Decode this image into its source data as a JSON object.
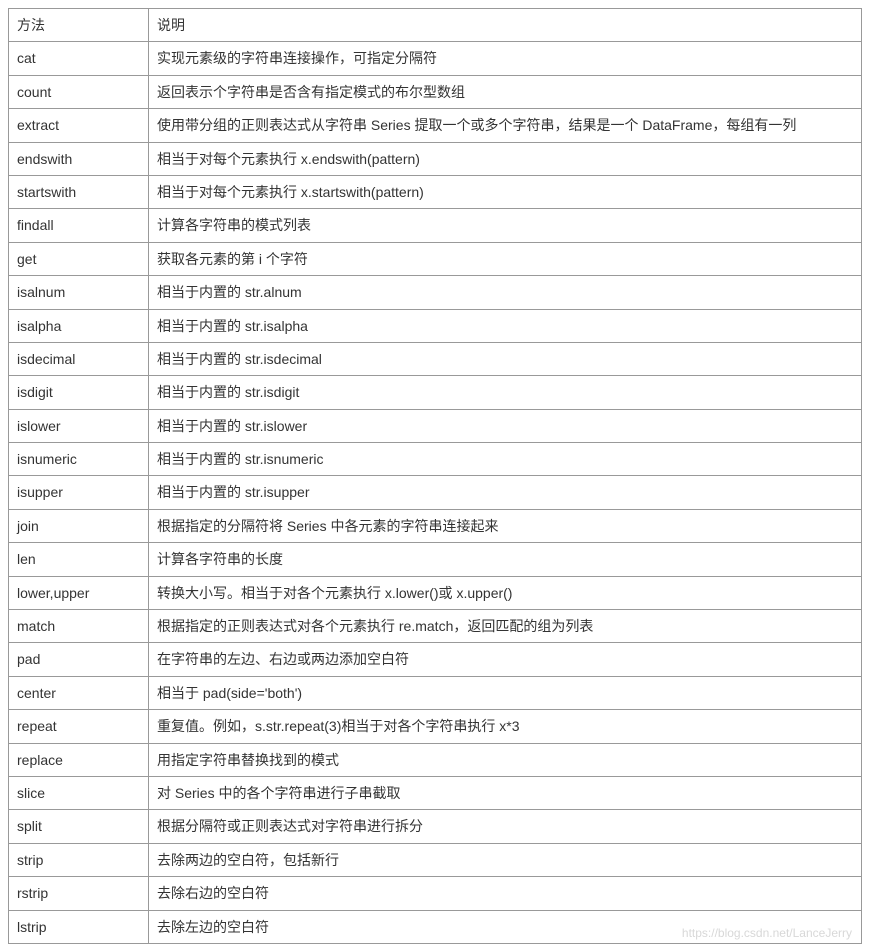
{
  "table": {
    "header": {
      "method": "方法",
      "desc": "说明"
    },
    "rows": [
      {
        "method": "cat",
        "desc": "实现元素级的字符串连接操作，可指定分隔符"
      },
      {
        "method": "count",
        "desc": "返回表示个字符串是否含有指定模式的布尔型数组"
      },
      {
        "method": "extract",
        "desc": "使用带分组的正则表达式从字符串 Series 提取一个或多个字符串，结果是一个 DataFrame，每组有一列"
      },
      {
        "method": "endswith",
        "desc": "相当于对每个元素执行 x.endswith(pattern)"
      },
      {
        "method": "startswith",
        "desc": "相当于对每个元素执行 x.startswith(pattern)"
      },
      {
        "method": "findall",
        "desc": "计算各字符串的模式列表"
      },
      {
        "method": "get",
        "desc": "获取各元素的第 i 个字符"
      },
      {
        "method": "isalnum",
        "desc": "相当于内置的 str.alnum"
      },
      {
        "method": "isalpha",
        "desc": "相当于内置的 str.isalpha"
      },
      {
        "method": "isdecimal",
        "desc": "相当于内置的 str.isdecimal"
      },
      {
        "method": "isdigit",
        "desc": "相当于内置的 str.isdigit"
      },
      {
        "method": "islower",
        "desc": "相当于内置的 str.islower"
      },
      {
        "method": "isnumeric",
        "desc": "相当于内置的 str.isnumeric"
      },
      {
        "method": "isupper",
        "desc": "相当于内置的 str.isupper"
      },
      {
        "method": "join",
        "desc": "根据指定的分隔符将 Series 中各元素的字符串连接起来"
      },
      {
        "method": "len",
        "desc": "计算各字符串的长度"
      },
      {
        "method": "lower,upper",
        "desc": "转换大小写。相当于对各个元素执行 x.lower()或 x.upper()"
      },
      {
        "method": "match",
        "desc": "根据指定的正则表达式对各个元素执行 re.match，返回匹配的组为列表"
      },
      {
        "method": "pad",
        "desc": "在字符串的左边、右边或两边添加空白符"
      },
      {
        "method": "center",
        "desc": "相当于 pad(side='both')"
      },
      {
        "method": "repeat",
        "desc": "重复值。例如，s.str.repeat(3)相当于对各个字符串执行 x*3"
      },
      {
        "method": "replace",
        "desc": "用指定字符串替换找到的模式"
      },
      {
        "method": "slice",
        "desc": "对 Series 中的各个字符串进行子串截取"
      },
      {
        "method": "split",
        "desc": "根据分隔符或正则表达式对字符串进行拆分"
      },
      {
        "method": "strip",
        "desc": "去除两边的空白符，包括新行"
      },
      {
        "method": "rstrip",
        "desc": "去除右边的空白符"
      },
      {
        "method": "lstrip",
        "desc": "去除左边的空白符"
      }
    ]
  },
  "watermark": "https://blog.csdn.net/LanceJerry"
}
